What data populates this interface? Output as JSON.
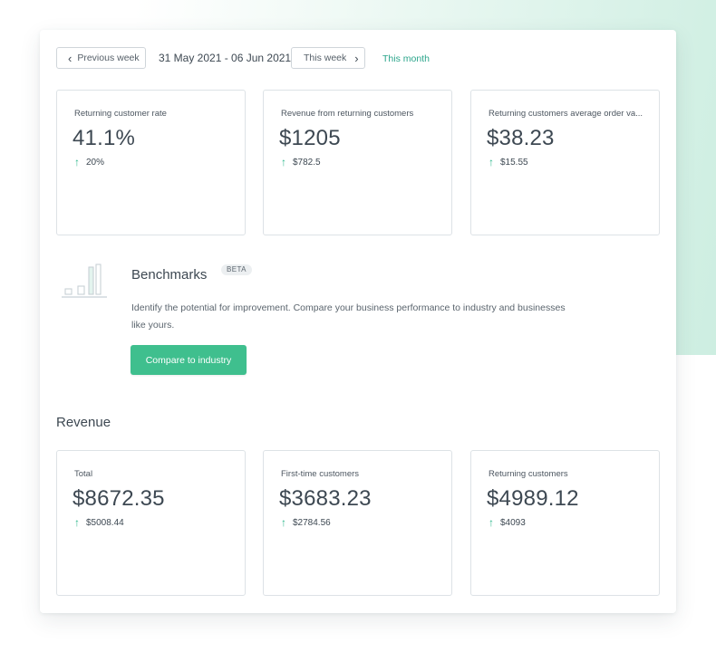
{
  "toolbar": {
    "prev_label": "Previous week",
    "date_range": "31 May 2021 - 06 Jun 2021",
    "this_week_label": "This week",
    "this_month_label": "This month"
  },
  "returning_metrics": [
    {
      "label": "Returning customer rate",
      "value": "41.1%",
      "change": "20%"
    },
    {
      "label": "Revenue from returning customers",
      "value": "$1205",
      "change": "$782.5"
    },
    {
      "label": "Returning customers average order va...",
      "value": "$38.23",
      "change": "$15.55"
    }
  ],
  "benchmarks": {
    "title": "Benchmarks",
    "badge": "BETA",
    "description": "Identify the potential for improvement. Compare your business performance to industry and businesses like yours.",
    "button_label": "Compare to industry"
  },
  "revenue": {
    "title": "Revenue",
    "cards": [
      {
        "label": "Total",
        "value": "$8672.35",
        "change": "$5008.44"
      },
      {
        "label": "First-time customers",
        "value": "$3683.23",
        "change": "$2784.56"
      },
      {
        "label": "Returning customers",
        "value": "$4989.12",
        "change": "$4093"
      }
    ]
  },
  "icons": {
    "chevron_left": "‹",
    "chevron_right": "›",
    "arrow_up": "↑"
  },
  "colors": {
    "accent": "#3fbf8e",
    "link": "#2ba58b",
    "trend_up": "#2fb88d",
    "background_accent": "#cdeee1"
  }
}
